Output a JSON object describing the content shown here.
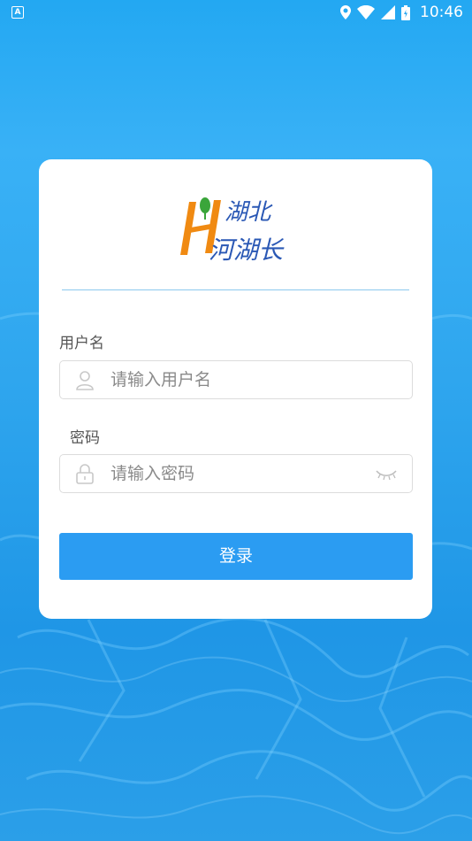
{
  "status_bar": {
    "notification_letter": "A",
    "time": "10:46"
  },
  "logo": {
    "letter": "H",
    "line1": "湖北",
    "line2": "河湖长"
  },
  "form": {
    "username_label": "用户名",
    "username_placeholder": "请输入用户名",
    "password_label": "密码",
    "password_placeholder": "请输入密码",
    "login_label": "登录"
  },
  "colors": {
    "background": "#2fa6ee",
    "button": "#2b9cf2",
    "divider": "#8cc8ee"
  }
}
